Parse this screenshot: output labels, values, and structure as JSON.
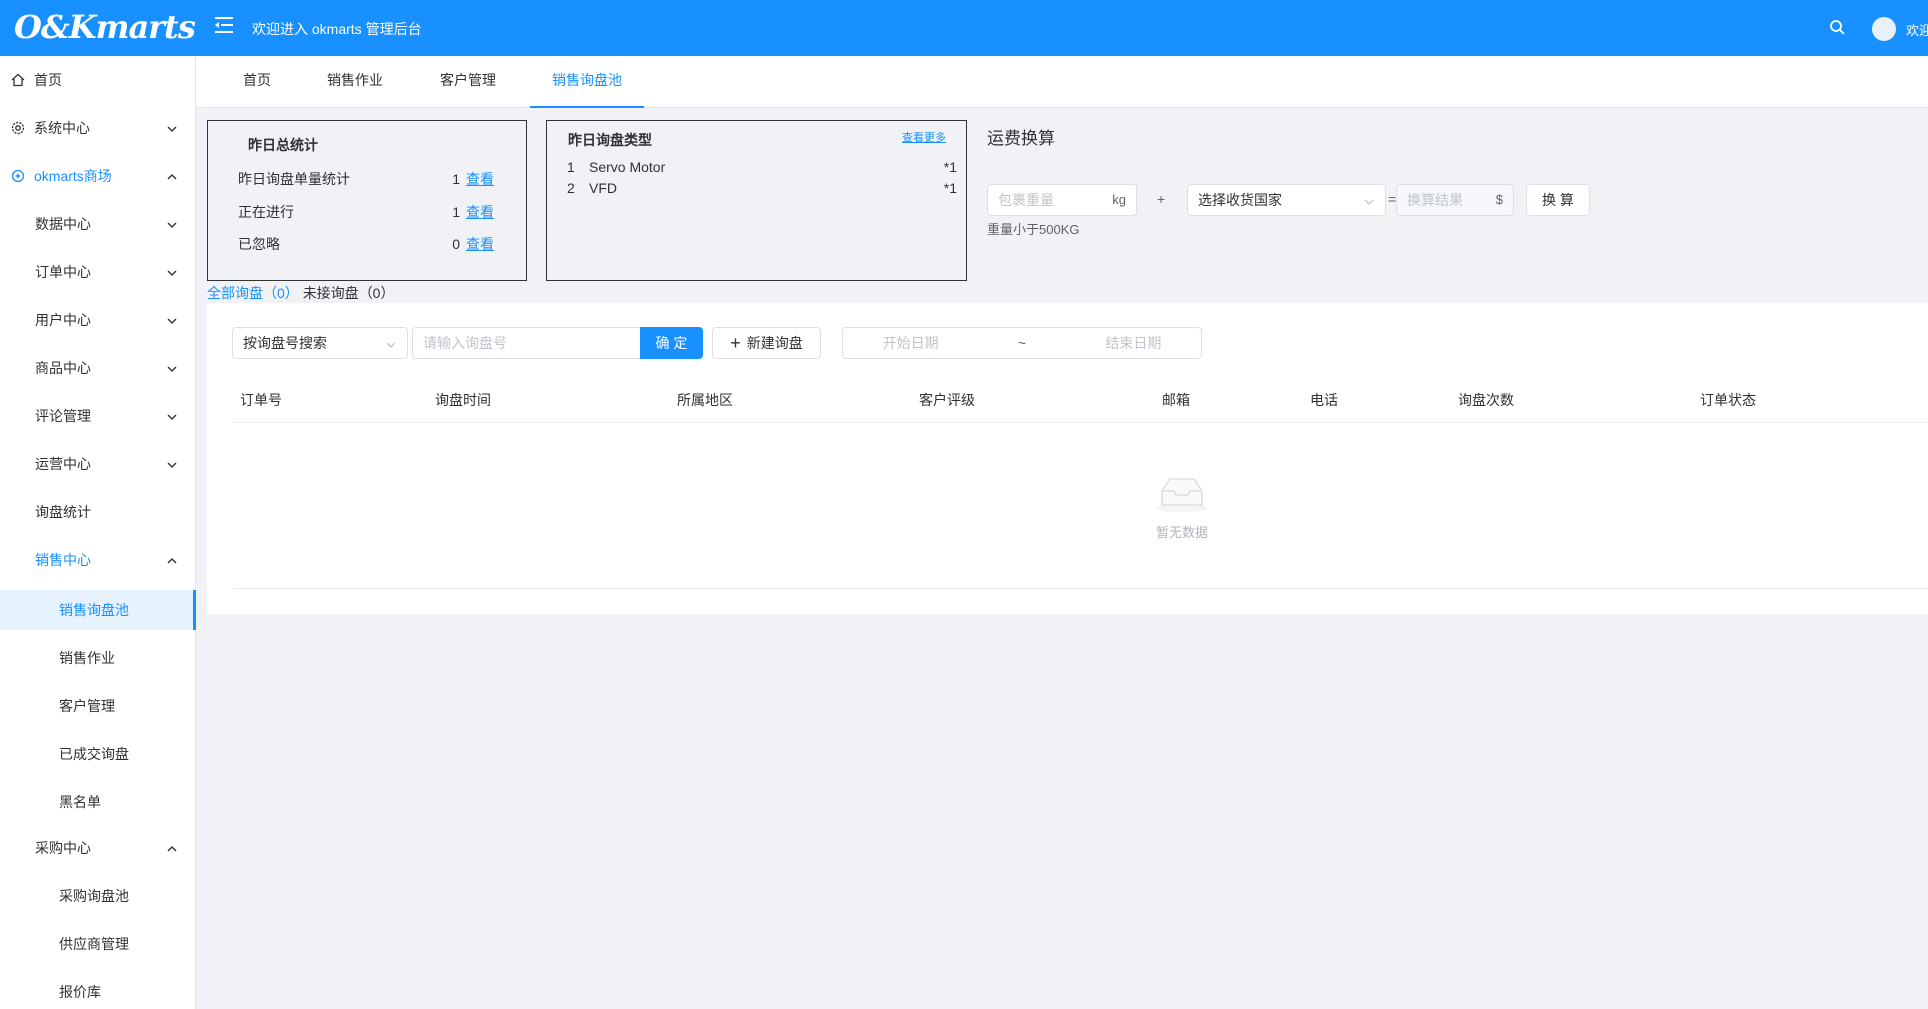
{
  "header": {
    "logo": "O&Kmarts",
    "welcome": "欢迎进入 okmarts 管理后台",
    "user_text": "欢迎"
  },
  "sidebar": {
    "items": [
      {
        "label": "首页",
        "icon": "home-icon"
      },
      {
        "label": "系统中心",
        "icon": "gear-icon"
      },
      {
        "label": "okmarts商场",
        "icon": "shop-icon"
      },
      {
        "label": "数据中心"
      },
      {
        "label": "订单中心"
      },
      {
        "label": "用户中心"
      },
      {
        "label": "商品中心"
      },
      {
        "label": "评论管理"
      },
      {
        "label": "运营中心"
      },
      {
        "label": "询盘统计"
      },
      {
        "label": "销售中心"
      },
      {
        "label": "销售询盘池"
      },
      {
        "label": "销售作业"
      },
      {
        "label": "客户管理"
      },
      {
        "label": "已成交询盘"
      },
      {
        "label": "黑名单"
      },
      {
        "label": "采购中心"
      },
      {
        "label": "采购询盘池"
      },
      {
        "label": "供应商管理"
      },
      {
        "label": "报价库"
      }
    ]
  },
  "tabs": [
    "首页",
    "销售作业",
    "客户管理",
    "销售询盘池"
  ],
  "yesterday_stats": {
    "title": "昨日总统计",
    "rows": [
      {
        "label": "昨日询盘单量统计",
        "value": "1",
        "link": "查看"
      },
      {
        "label": "正在进行",
        "value": "1",
        "link": "查看"
      },
      {
        "label": "已忽略",
        "value": "0",
        "link": "查看"
      }
    ]
  },
  "inquiry_types": {
    "title": "昨日询盘类型",
    "more_link": "查看更多",
    "rows": [
      {
        "index": "1",
        "name": "Servo Motor",
        "count": "*1"
      },
      {
        "index": "2",
        "name": "VFD",
        "count": "*1"
      }
    ]
  },
  "freight": {
    "title": "运费换算",
    "weight_placeholder": "包裹重量",
    "weight_unit": "kg",
    "plus": "+",
    "country_placeholder": "选择收货国家",
    "equals": "=",
    "result_placeholder": "换算结果",
    "currency": "$",
    "convert_label": "换 算",
    "note": "重量小于500KG"
  },
  "filter": {
    "all_label": "全部询盘",
    "all_count": "（0）",
    "unreceived_label": "未接询盘",
    "unreceived_count": "（0）"
  },
  "search": {
    "mode_label": "按询盘号搜索",
    "input_placeholder": "请输入询盘号",
    "confirm_label": "确 定",
    "new_label": "新建询盘",
    "start_date": "开始日期",
    "separator": "~",
    "end_date": "结束日期"
  },
  "table": {
    "columns": [
      "订单号",
      "询盘时间",
      "所属地区",
      "客户评级",
      "邮箱",
      "电话",
      "询盘次数",
      "订单状态"
    ],
    "empty_text": "暂无数据"
  },
  "colors": {
    "primary": "#1890ff",
    "header_bg": "#1890ff",
    "page_bg": "#f0f2f5"
  }
}
